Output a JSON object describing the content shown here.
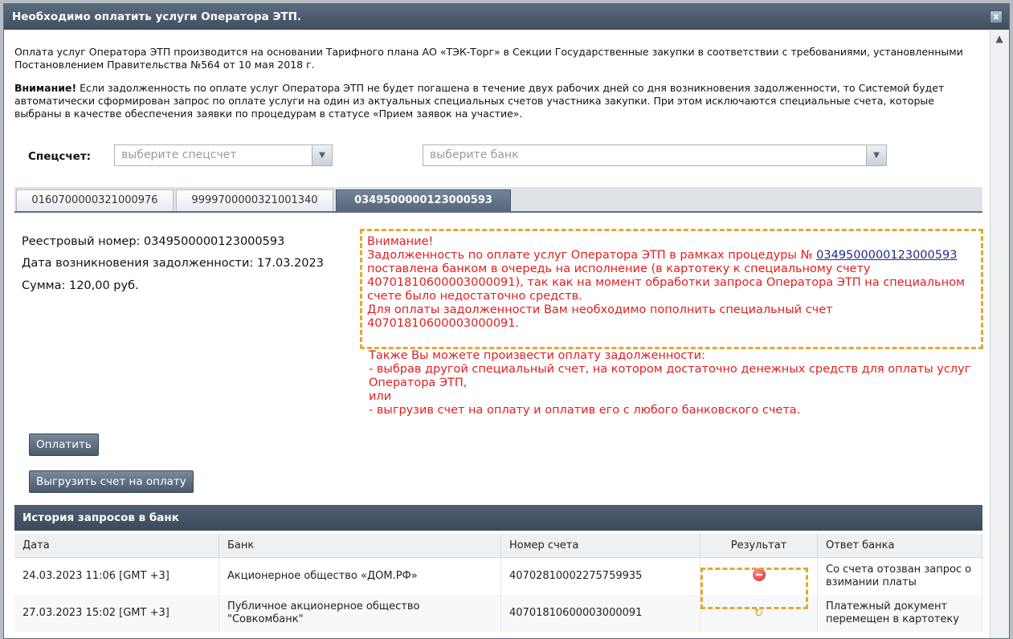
{
  "window": {
    "title": "Необходимо оплатить услуги Оператора ЭТП.",
    "close_label": "x"
  },
  "intro": "Оплата услуг Оператора ЭТП производится на основании Тарифного плана АО «ТЭК-Торг» в Секции Государственные закупки в соответствии с требованиями, установленными Постановлением Правительства №564 от 10 мая 2018 г.",
  "warning": {
    "prefix": "Внимание!",
    "text": " Если задолженность по оплате услуг Оператора ЭТП не будет погашена в течение двух рабочих дней со дня возникновения задолженности, то Системой будет автоматически сформирован запрос по оплате услуги на один из актуальных специальных счетов участника закупки. При этом исключаются специальные счета, которые выбраны в качестве обеспечения заявки по процедурам в статусе «Прием заявок на участие»."
  },
  "spec": {
    "label": "Спецсчет:",
    "account_placeholder": "выберите спецсчет",
    "bank_placeholder": "выберите банк"
  },
  "tabs": [
    "0160700000321000976",
    "9999700000321001340",
    "0349500000123000593"
  ],
  "details": {
    "reg_number": "Реестровый номер: 0349500000123000593",
    "debt_date": "Дата возникновения задолженности: 17.03.2023",
    "amount": "Сумма: 120,00 руб."
  },
  "alert": {
    "title": "Внимание!",
    "line1": "Задолженность по оплате услуг Оператора ЭТП в рамках процедуры №",
    "link": "0349500000123000593",
    "line2": " поставлена банком в очередь на исполнение (в картотеку к специальному счету 40701810600003000091), так как на момент обработки запроса Оператора ЭТП на специальном счете было недостаточно средств.",
    "line3": "Для оплаты задолженности Вам необходимо пополнить специальный счет 40701810600003000091.",
    "also1": "Также Вы можете произвести оплату задолженности:",
    "also2": "- выбрав другой специальный счет, на котором достаточно денежных средств для оплаты услуг Оператора ЭТП,",
    "also3": "или",
    "also4": "- выгрузив счет на оплату и оплатив его с любого банковского счета."
  },
  "buttons": {
    "pay": "Оплатить",
    "export": "Выгрузить счет на оплату"
  },
  "history": {
    "title": "История запросов в банк",
    "columns": [
      "Дата",
      "Банк",
      "Номер счета",
      "Результат",
      "Ответ банка"
    ],
    "rows": [
      {
        "date": "24.03.2023 11:06 [GMT +3]",
        "bank": "Акционерное общество «ДОМ.РФ»",
        "account": "40702810002275759935",
        "result_icon": "declined-icon",
        "answer": "Со счета отозван запрос о взимании платы"
      },
      {
        "date": "27.03.2023 15:02 [GMT +3]",
        "bank": "Публичное акционерное общество \"Совкомбанк\"",
        "account": "40701810600003000091",
        "result_icon": "pending-icon",
        "answer": "Платежный документ перемещен в картотеку"
      }
    ]
  },
  "colors": {
    "alert_red": "#e1201f",
    "highlight_orange": "#e5a82a",
    "header_dark": "#4f5f72"
  }
}
